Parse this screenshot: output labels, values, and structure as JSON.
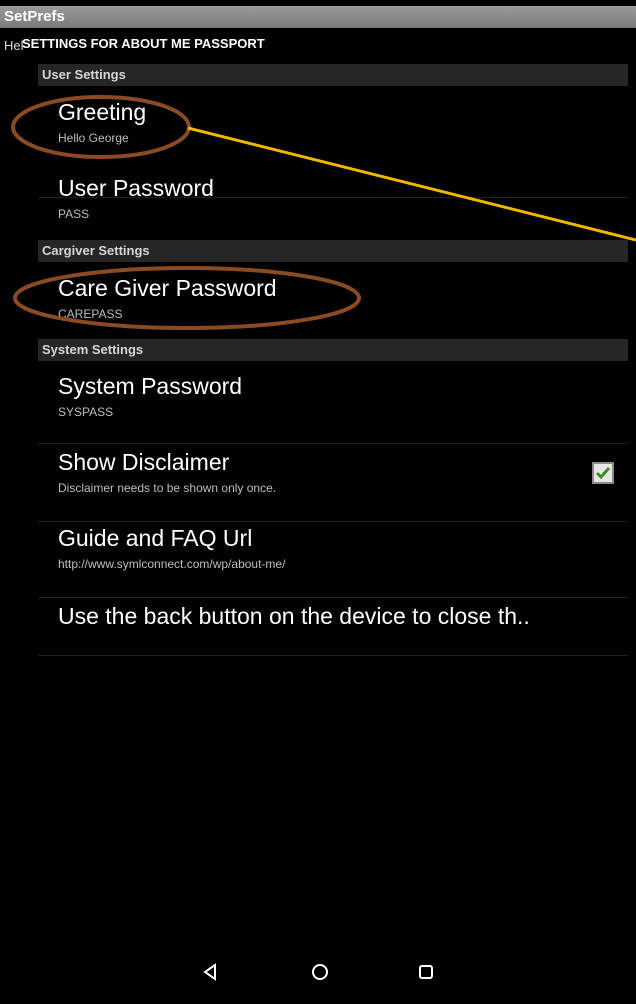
{
  "app": {
    "title": "SetPrefs",
    "clipped_text": "Hel"
  },
  "dialog": {
    "title": "SETTINGS FOR ABOUT ME PASSPORT"
  },
  "categories": [
    {
      "label": "User Settings"
    },
    {
      "label": "Cargiver Settings"
    },
    {
      "label": "System Settings"
    }
  ],
  "prefs": [
    {
      "title": "Greeting",
      "summary": "Hello George"
    },
    {
      "title": "User Password",
      "summary": "PASS"
    },
    {
      "title": "Care Giver Password",
      "summary": "CAREPASS"
    },
    {
      "title": "System  Password",
      "summary": "SYSPASS"
    },
    {
      "title": "Show Disclaimer",
      "summary": "Disclaimer needs to be shown only once.",
      "checked": true
    },
    {
      "title": "Guide and FAQ Url",
      "summary": "http://www.symlconnect.com/wp/about-me/"
    },
    {
      "title": "Use the back button on the device to close th..",
      "summary": ""
    }
  ],
  "navigation": {
    "back": "back-icon",
    "home": "home-icon",
    "recents": "recents-icon"
  },
  "annotation_colors": {
    "circle": "#8a4a22",
    "arrow": "#f0b800",
    "checkbox_check": "#3a8f1f"
  }
}
